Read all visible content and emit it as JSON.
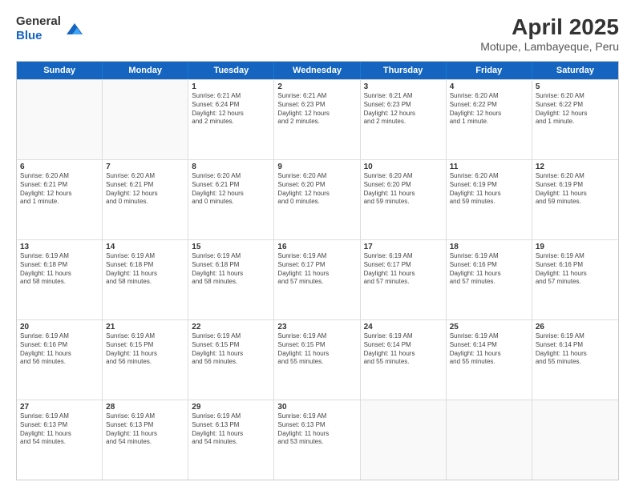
{
  "header": {
    "logo_general": "General",
    "logo_blue": "Blue",
    "month_year": "April 2025",
    "location": "Motupe, Lambayeque, Peru"
  },
  "days": [
    "Sunday",
    "Monday",
    "Tuesday",
    "Wednesday",
    "Thursday",
    "Friday",
    "Saturday"
  ],
  "weeks": [
    [
      {
        "num": "",
        "lines": []
      },
      {
        "num": "",
        "lines": []
      },
      {
        "num": "1",
        "lines": [
          "Sunrise: 6:21 AM",
          "Sunset: 6:24 PM",
          "Daylight: 12 hours",
          "and 2 minutes."
        ]
      },
      {
        "num": "2",
        "lines": [
          "Sunrise: 6:21 AM",
          "Sunset: 6:23 PM",
          "Daylight: 12 hours",
          "and 2 minutes."
        ]
      },
      {
        "num": "3",
        "lines": [
          "Sunrise: 6:21 AM",
          "Sunset: 6:23 PM",
          "Daylight: 12 hours",
          "and 2 minutes."
        ]
      },
      {
        "num": "4",
        "lines": [
          "Sunrise: 6:20 AM",
          "Sunset: 6:22 PM",
          "Daylight: 12 hours",
          "and 1 minute."
        ]
      },
      {
        "num": "5",
        "lines": [
          "Sunrise: 6:20 AM",
          "Sunset: 6:22 PM",
          "Daylight: 12 hours",
          "and 1 minute."
        ]
      }
    ],
    [
      {
        "num": "6",
        "lines": [
          "Sunrise: 6:20 AM",
          "Sunset: 6:21 PM",
          "Daylight: 12 hours",
          "and 1 minute."
        ]
      },
      {
        "num": "7",
        "lines": [
          "Sunrise: 6:20 AM",
          "Sunset: 6:21 PM",
          "Daylight: 12 hours",
          "and 0 minutes."
        ]
      },
      {
        "num": "8",
        "lines": [
          "Sunrise: 6:20 AM",
          "Sunset: 6:21 PM",
          "Daylight: 12 hours",
          "and 0 minutes."
        ]
      },
      {
        "num": "9",
        "lines": [
          "Sunrise: 6:20 AM",
          "Sunset: 6:20 PM",
          "Daylight: 12 hours",
          "and 0 minutes."
        ]
      },
      {
        "num": "10",
        "lines": [
          "Sunrise: 6:20 AM",
          "Sunset: 6:20 PM",
          "Daylight: 11 hours",
          "and 59 minutes."
        ]
      },
      {
        "num": "11",
        "lines": [
          "Sunrise: 6:20 AM",
          "Sunset: 6:19 PM",
          "Daylight: 11 hours",
          "and 59 minutes."
        ]
      },
      {
        "num": "12",
        "lines": [
          "Sunrise: 6:20 AM",
          "Sunset: 6:19 PM",
          "Daylight: 11 hours",
          "and 59 minutes."
        ]
      }
    ],
    [
      {
        "num": "13",
        "lines": [
          "Sunrise: 6:19 AM",
          "Sunset: 6:18 PM",
          "Daylight: 11 hours",
          "and 58 minutes."
        ]
      },
      {
        "num": "14",
        "lines": [
          "Sunrise: 6:19 AM",
          "Sunset: 6:18 PM",
          "Daylight: 11 hours",
          "and 58 minutes."
        ]
      },
      {
        "num": "15",
        "lines": [
          "Sunrise: 6:19 AM",
          "Sunset: 6:18 PM",
          "Daylight: 11 hours",
          "and 58 minutes."
        ]
      },
      {
        "num": "16",
        "lines": [
          "Sunrise: 6:19 AM",
          "Sunset: 6:17 PM",
          "Daylight: 11 hours",
          "and 57 minutes."
        ]
      },
      {
        "num": "17",
        "lines": [
          "Sunrise: 6:19 AM",
          "Sunset: 6:17 PM",
          "Daylight: 11 hours",
          "and 57 minutes."
        ]
      },
      {
        "num": "18",
        "lines": [
          "Sunrise: 6:19 AM",
          "Sunset: 6:16 PM",
          "Daylight: 11 hours",
          "and 57 minutes."
        ]
      },
      {
        "num": "19",
        "lines": [
          "Sunrise: 6:19 AM",
          "Sunset: 6:16 PM",
          "Daylight: 11 hours",
          "and 57 minutes."
        ]
      }
    ],
    [
      {
        "num": "20",
        "lines": [
          "Sunrise: 6:19 AM",
          "Sunset: 6:16 PM",
          "Daylight: 11 hours",
          "and 56 minutes."
        ]
      },
      {
        "num": "21",
        "lines": [
          "Sunrise: 6:19 AM",
          "Sunset: 6:15 PM",
          "Daylight: 11 hours",
          "and 56 minutes."
        ]
      },
      {
        "num": "22",
        "lines": [
          "Sunrise: 6:19 AM",
          "Sunset: 6:15 PM",
          "Daylight: 11 hours",
          "and 56 minutes."
        ]
      },
      {
        "num": "23",
        "lines": [
          "Sunrise: 6:19 AM",
          "Sunset: 6:15 PM",
          "Daylight: 11 hours",
          "and 55 minutes."
        ]
      },
      {
        "num": "24",
        "lines": [
          "Sunrise: 6:19 AM",
          "Sunset: 6:14 PM",
          "Daylight: 11 hours",
          "and 55 minutes."
        ]
      },
      {
        "num": "25",
        "lines": [
          "Sunrise: 6:19 AM",
          "Sunset: 6:14 PM",
          "Daylight: 11 hours",
          "and 55 minutes."
        ]
      },
      {
        "num": "26",
        "lines": [
          "Sunrise: 6:19 AM",
          "Sunset: 6:14 PM",
          "Daylight: 11 hours",
          "and 55 minutes."
        ]
      }
    ],
    [
      {
        "num": "27",
        "lines": [
          "Sunrise: 6:19 AM",
          "Sunset: 6:13 PM",
          "Daylight: 11 hours",
          "and 54 minutes."
        ]
      },
      {
        "num": "28",
        "lines": [
          "Sunrise: 6:19 AM",
          "Sunset: 6:13 PM",
          "Daylight: 11 hours",
          "and 54 minutes."
        ]
      },
      {
        "num": "29",
        "lines": [
          "Sunrise: 6:19 AM",
          "Sunset: 6:13 PM",
          "Daylight: 11 hours",
          "and 54 minutes."
        ]
      },
      {
        "num": "30",
        "lines": [
          "Sunrise: 6:19 AM",
          "Sunset: 6:13 PM",
          "Daylight: 11 hours",
          "and 53 minutes."
        ]
      },
      {
        "num": "",
        "lines": []
      },
      {
        "num": "",
        "lines": []
      },
      {
        "num": "",
        "lines": []
      }
    ]
  ]
}
